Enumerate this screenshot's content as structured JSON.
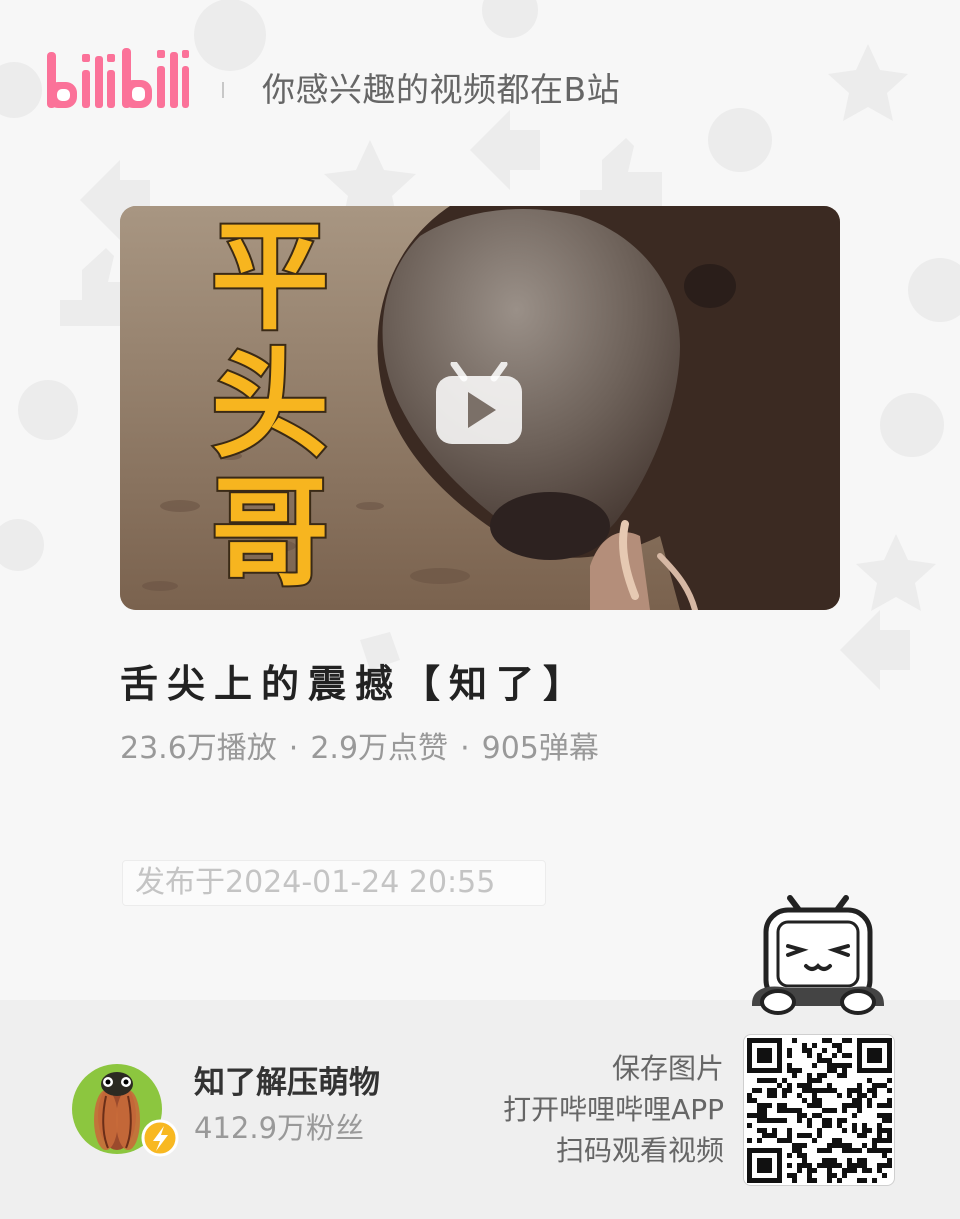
{
  "header": {
    "brand_logo": "bilibili",
    "slogan": "你感兴趣的视频都在B站"
  },
  "video": {
    "thumbnail_text": "平头哥",
    "title": "舌尖上的震撼【知了】",
    "play_icon": "tv-play-icon",
    "stats": {
      "plays": "23.6万播放",
      "likes": "2.9万点赞",
      "danmaku": "905弹幕",
      "separator": "·"
    },
    "published": "发布于2024-01-24 20:55"
  },
  "uploader": {
    "name": "知了解压萌物",
    "fans": "412.9万粉丝",
    "badge_icon": "lightning-icon"
  },
  "qr_section": {
    "lines": [
      "保存图片",
      "打开哔哩哔哩APP",
      "扫码观看视频"
    ]
  },
  "colors": {
    "brand_pink": "#fb7299",
    "title_yellow": "#f7b51f",
    "badge_yellow": "#f8b821",
    "avatar_green": "#8cc63f"
  }
}
